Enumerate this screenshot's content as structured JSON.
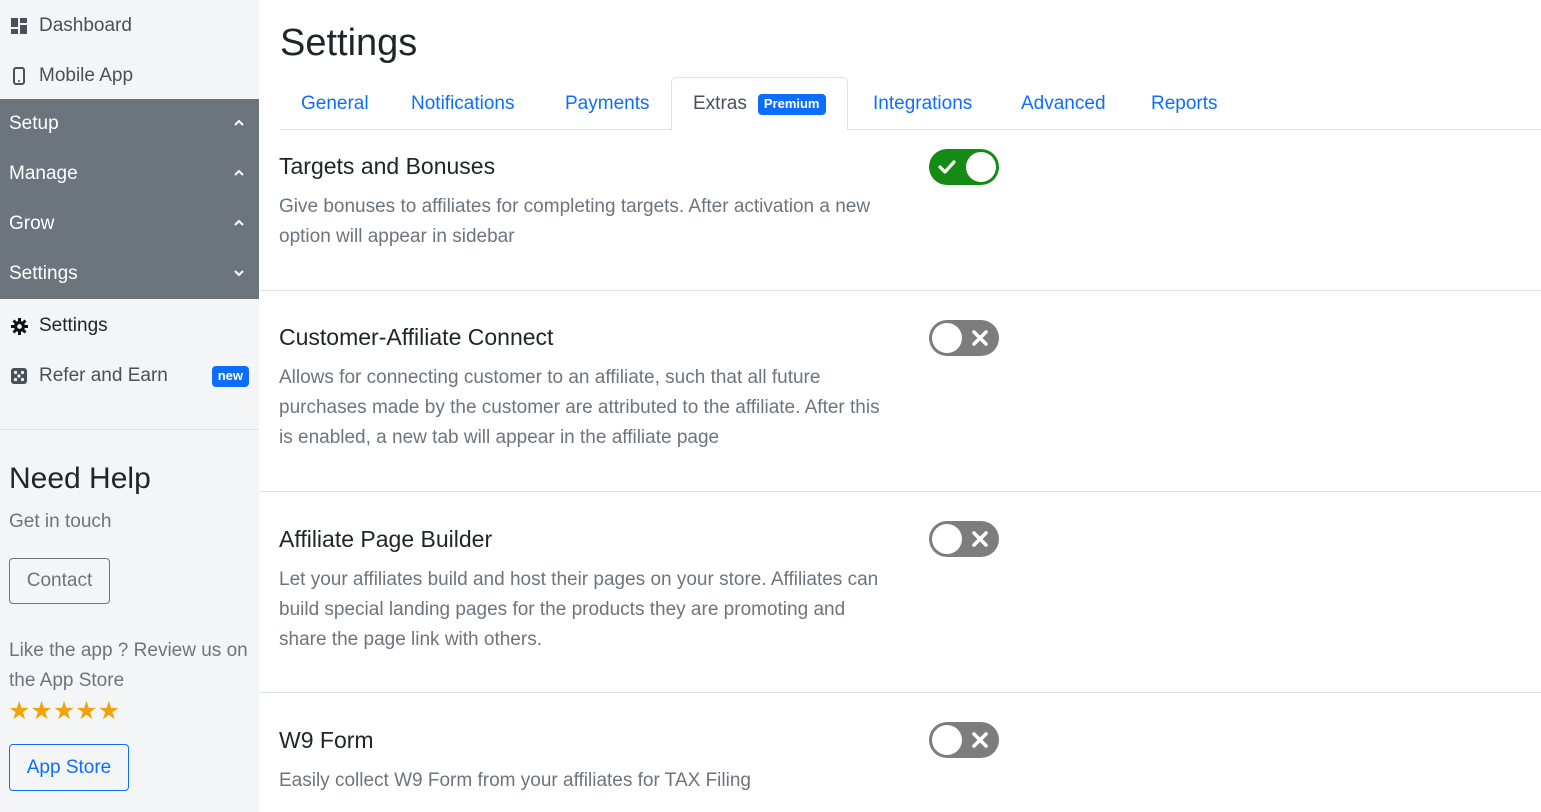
{
  "sidebar": {
    "items": [
      {
        "label": "Dashboard",
        "icon": "dashboard-icon"
      },
      {
        "label": "Mobile App",
        "icon": "mobile-icon"
      }
    ],
    "sections": [
      {
        "label": "Setup",
        "chevron": "up"
      },
      {
        "label": "Manage",
        "chevron": "up"
      },
      {
        "label": "Grow",
        "chevron": "up"
      },
      {
        "label": "Settings",
        "chevron": "down"
      }
    ],
    "sub_items": [
      {
        "label": "Settings",
        "icon": "gear-icon"
      },
      {
        "label": "Refer and Earn",
        "icon": "dice-icon",
        "badge": "new"
      }
    ],
    "help": {
      "title": "Need Help",
      "subtitle": "Get in touch",
      "contact_label": "Contact",
      "review_text": "Like the app ? Review us on the App Store",
      "stars": "★★★★★",
      "rating": 5,
      "appstore_label": "App Store"
    }
  },
  "main": {
    "title": "Settings",
    "tabs": [
      {
        "label": "General"
      },
      {
        "label": "Notifications"
      },
      {
        "label": "Payments"
      },
      {
        "label": "Extras",
        "badge": "Premium",
        "active": true
      },
      {
        "label": "Integrations"
      },
      {
        "label": "Advanced"
      },
      {
        "label": "Reports"
      }
    ],
    "settings": [
      {
        "title": "Targets and Bonuses",
        "description": "Give bonuses to affiliates for completing targets. After activation a new option will appear in sidebar",
        "enabled": true
      },
      {
        "title": "Customer-Affiliate Connect",
        "description": "Allows for connecting customer to an affiliate, such that all future purchases made by the customer are attributed to the affiliate. After this is enabled, a new tab will appear in the affiliate page",
        "enabled": false
      },
      {
        "title": "Affiliate Page Builder",
        "description": "Let your affiliates build and host their pages on your store. Affiliates can build special landing pages for the products they are promoting and share the page link with others.",
        "enabled": false
      },
      {
        "title": "W9 Form",
        "description": "Easily collect W9 Form from your affiliates for TAX Filing",
        "enabled": false
      }
    ]
  },
  "colors": {
    "sidebar_bg": "#f4f5f7",
    "section_bg": "#6c757d",
    "accent": "#0d6efd",
    "toggle_on": "#158a15",
    "toggle_off": "#7d7d7d",
    "star": "#f0a30a"
  }
}
